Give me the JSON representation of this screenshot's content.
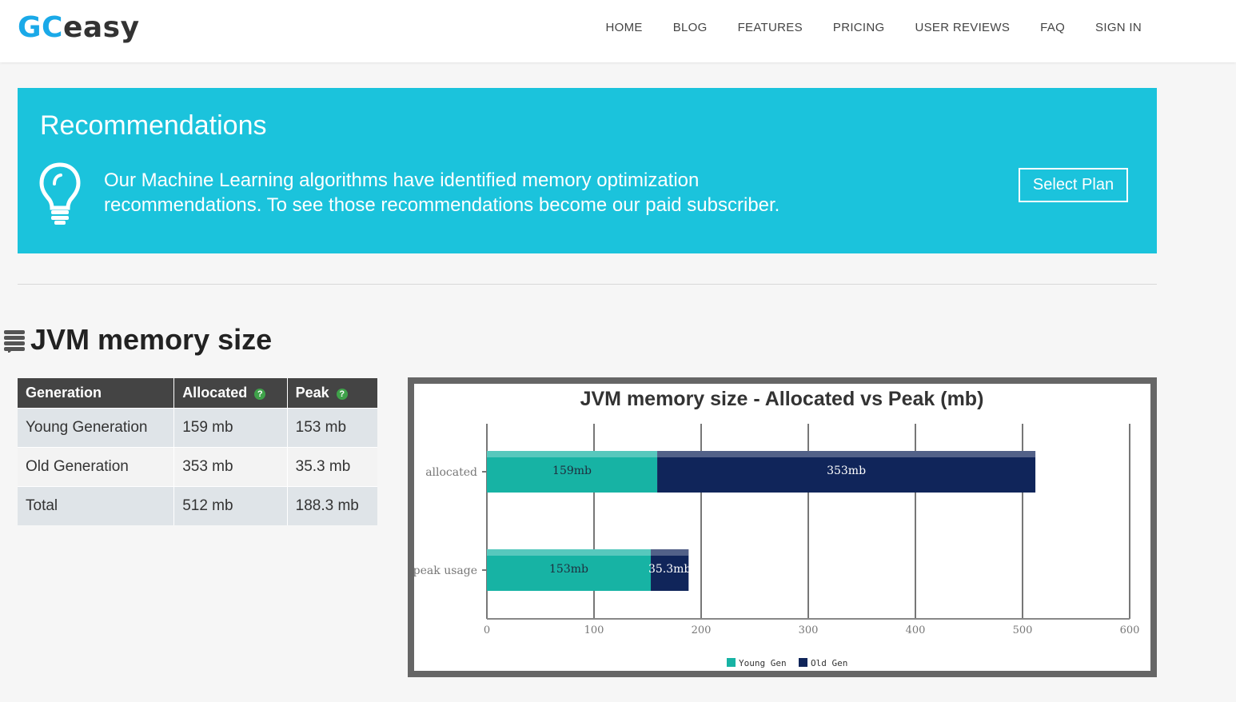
{
  "header": {
    "logo_gc": "GC",
    "logo_easy": "easy",
    "nav": [
      "HOME",
      "BLOG",
      "FEATURES",
      "PRICING",
      "USER REVIEWS",
      "FAQ",
      "SIGN IN"
    ]
  },
  "recommendations": {
    "title": "Recommendations",
    "text": "Our Machine Learning algorithms have identified memory optimization recommendations. To see those recommendations become our paid subscriber.",
    "button": "Select Plan",
    "icon": "lightbulb-icon",
    "bg_color": "#1bc3dc"
  },
  "section": {
    "title": "JVM memory size",
    "icon": "stack-icon"
  },
  "table": {
    "headers": [
      "Generation",
      "Allocated",
      "Peak"
    ],
    "rows": [
      [
        "Young Generation",
        "159 mb",
        "153 mb"
      ],
      [
        "Old Generation",
        "353 mb",
        "35.3 mb"
      ],
      [
        "Total",
        "512 mb",
        "188.3 mb"
      ]
    ]
  },
  "chart_data": {
    "type": "bar",
    "orientation": "horizontal",
    "stacked": true,
    "title": "JVM memory size - Allocated vs Peak (mb)",
    "categories": [
      "allocated",
      "peak usage"
    ],
    "series": [
      {
        "name": "Young Gen",
        "values": [
          159,
          153
        ],
        "labels": [
          "159mb",
          "153mb"
        ],
        "color": "#17b3a4"
      },
      {
        "name": "Old Gen",
        "values": [
          353,
          35.3
        ],
        "labels": [
          "353mb",
          "35.3mb"
        ],
        "color": "#10255a"
      }
    ],
    "xlim": [
      0,
      600
    ],
    "xticks": [
      0,
      100,
      200,
      300,
      400,
      500,
      600
    ],
    "grid": true,
    "legend": "bottom"
  }
}
